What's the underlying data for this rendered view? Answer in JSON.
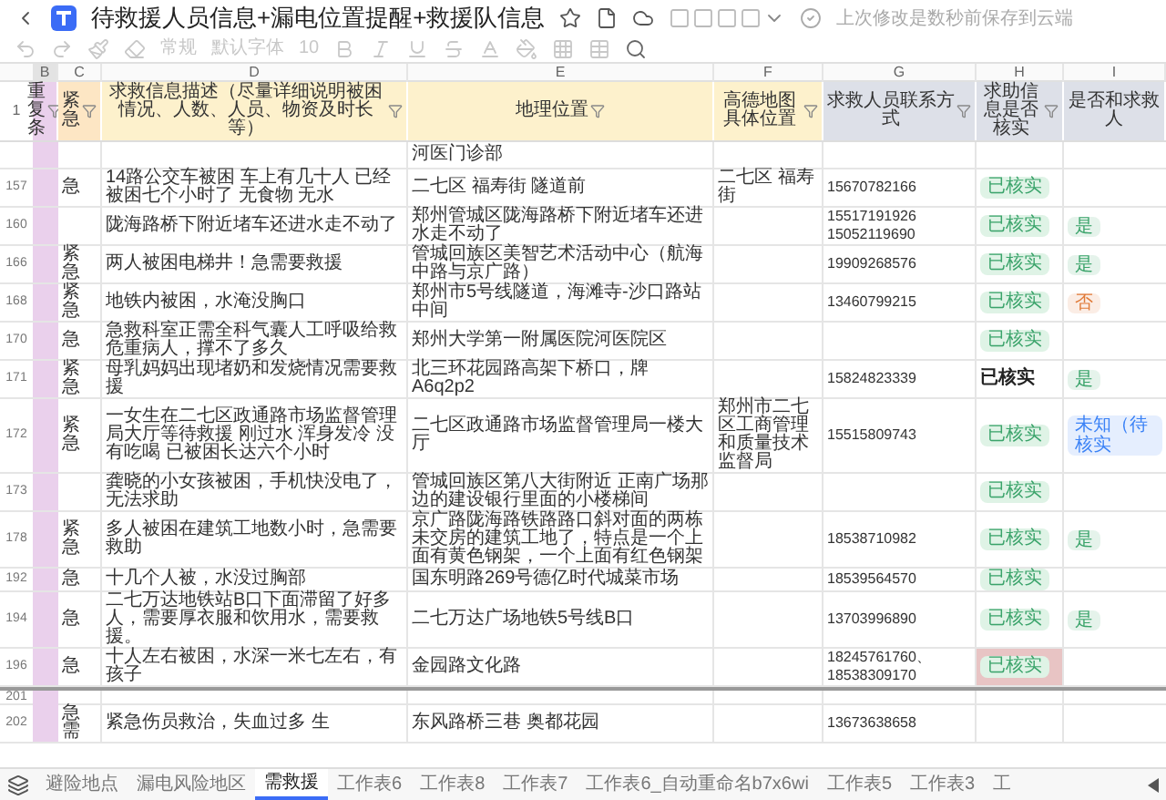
{
  "window": {
    "title": "待救援人员信息+漏电位置提醒+救援队信息",
    "save_status": "上次修改是数秒前保存到云端"
  },
  "toolbar": {
    "format": "常规",
    "font": "默认字体",
    "size": "10"
  },
  "column_letters": [
    "B",
    "C",
    "D",
    "E",
    "F",
    "G",
    "H",
    "I"
  ],
  "header": {
    "number": "1",
    "columns": [
      "重复条",
      "紧急",
      "求救信息描述（尽量详细说明被困情况、人数、人员、物资及时长等）",
      "地理位置",
      "高德地图具体位置",
      "求救人员联系方式",
      "求助信息是否核实",
      "是否和求救人"
    ]
  },
  "rows": [
    {
      "e": "河医门诊部"
    },
    {
      "number": "157",
      "c": "急",
      "d": "14路公交车被困 车上有几十人 已经被困七个小时了 无食物 无水",
      "e": "二七区 福寿街 隧道前",
      "f": "二七区 福寿街",
      "g": "15670782166",
      "h": {
        "text": "已核实",
        "kind": "tag"
      }
    },
    {
      "number": "160",
      "d": "陇海路桥下附近堵车还进水走不动了",
      "e": "郑州管城区陇海路桥下附近堵车还进水走不动了",
      "g": "15517191926 15052119690",
      "h": {
        "text": "已核实",
        "kind": "tag"
      },
      "i": {
        "text": "是",
        "color": "#3aa36a"
      }
    },
    {
      "number": "166",
      "c": "紧急",
      "d": "两人被困电梯井！急需要救援",
      "e": "管城回族区美智艺术活动中心（航海中路与京广路）",
      "g": "19909268576",
      "h": {
        "text": "已核实",
        "kind": "tag"
      },
      "i": {
        "text": "是",
        "color": "#3aa36a"
      }
    },
    {
      "number": "168",
      "c": "紧急",
      "d": "地铁内被困，水淹没胸口",
      "e": "郑州市5号线隧道，海滩寺-沙口路站中间",
      "g": "13460799215",
      "h": {
        "text": "已核实",
        "kind": "tag"
      },
      "i": {
        "text": "否",
        "color": "#e07b39"
      }
    },
    {
      "number": "170",
      "c": "急",
      "d": "急救科室正需全科气囊人工呼吸给救危重病人，撑不了多久",
      "e": "郑州大学第一附属医院河医院区",
      "h": {
        "text": "已核实",
        "kind": "tag"
      }
    },
    {
      "number": "171",
      "c": "紧急",
      "d": "母乳妈妈出现堵奶和发烧情况需要救援",
      "e": "北三环花园路高架下桥口，牌A6q2p2",
      "g": "15824823339",
      "h": {
        "text": "已核实",
        "kind": "bold"
      },
      "i": {
        "text": "是",
        "color": "#3aa36a"
      }
    },
    {
      "number": "172",
      "c": "紧急",
      "d": "一女生在二七区政通路市场监督管理局大厅等待救援 刚过水 浑身发冷 没有吃喝 已被困长达六个小时",
      "e": "二七区政通路市场监督管理局一楼大厅",
      "f": "郑州市二七区工商管理和质量技术监督局",
      "g": "15515809743",
      "h": {
        "text": "已核实",
        "kind": "tag"
      },
      "i": {
        "text": "未知（待核实",
        "color": "#3b82f6"
      }
    },
    {
      "number": "173",
      "d": "龚晓的小女孩被困，手机快没电了，无法求助",
      "e": "管城回族区第八大街附近 正南广场那边的建设银行里面的小楼梯间",
      "h": {
        "text": "已核实",
        "kind": "tag"
      }
    },
    {
      "number": "178",
      "c": "紧急",
      "d": "多人被困在建筑工地数小时，急需要救助",
      "e": "京广路陇海路铁路路口斜对面的两栋未交房的建筑工地了，特点是一个上面有黄色钢架，一个上面有红色钢架",
      "g": "18538710982",
      "h": {
        "text": "已核实",
        "kind": "tag"
      },
      "i": {
        "text": "是",
        "color": "#3aa36a"
      }
    },
    {
      "number": "192",
      "c": "急",
      "d": "十几个人被，水没过胸部",
      "e": "国东明路269号德亿时代城菜市场",
      "g": "18539564570",
      "h": {
        "text": "已核实",
        "kind": "tag"
      }
    },
    {
      "number": "194",
      "c": "急",
      "d": "二七万达地铁站B口下面滞留了好多人，需要厚衣服和饮用水，需要救援。",
      "e": "二七万达广场地铁5号线B口",
      "g": "13703996890",
      "h": {
        "text": "已核实",
        "kind": "tag"
      },
      "i": {
        "text": "是",
        "color": "#3aa36a"
      }
    },
    {
      "number": "196",
      "c": "急",
      "d": "十人左右被困，水深一米七左右，有孩子",
      "e": "金园路文化路",
      "g": "18245761760、18538309170",
      "h": {
        "text": "已核实",
        "kind": "tag"
      },
      "highlighted": true
    },
    {
      "number": "201",
      "divider": true
    },
    {
      "number": "202",
      "c": "急需",
      "d": "紧急伤员救治，失血过多 生",
      "e": "东风路桥三巷 奥都花园",
      "g": "13673638658"
    }
  ],
  "sheet_tabs": [
    {
      "label": "避险地点",
      "selected": false
    },
    {
      "label": "漏电风险地区",
      "selected": false
    },
    {
      "label": "需救援",
      "selected": true
    },
    {
      "label": "工作表6",
      "selected": false
    },
    {
      "label": "工作表8",
      "selected": false
    },
    {
      "label": "工作表7",
      "selected": false
    },
    {
      "label": "工作表6_自动重命名b7x6wi",
      "selected": false
    },
    {
      "label": "工作表5",
      "selected": false
    },
    {
      "label": "工作表3",
      "selected": false
    },
    {
      "label": "工",
      "selected": false
    }
  ]
}
